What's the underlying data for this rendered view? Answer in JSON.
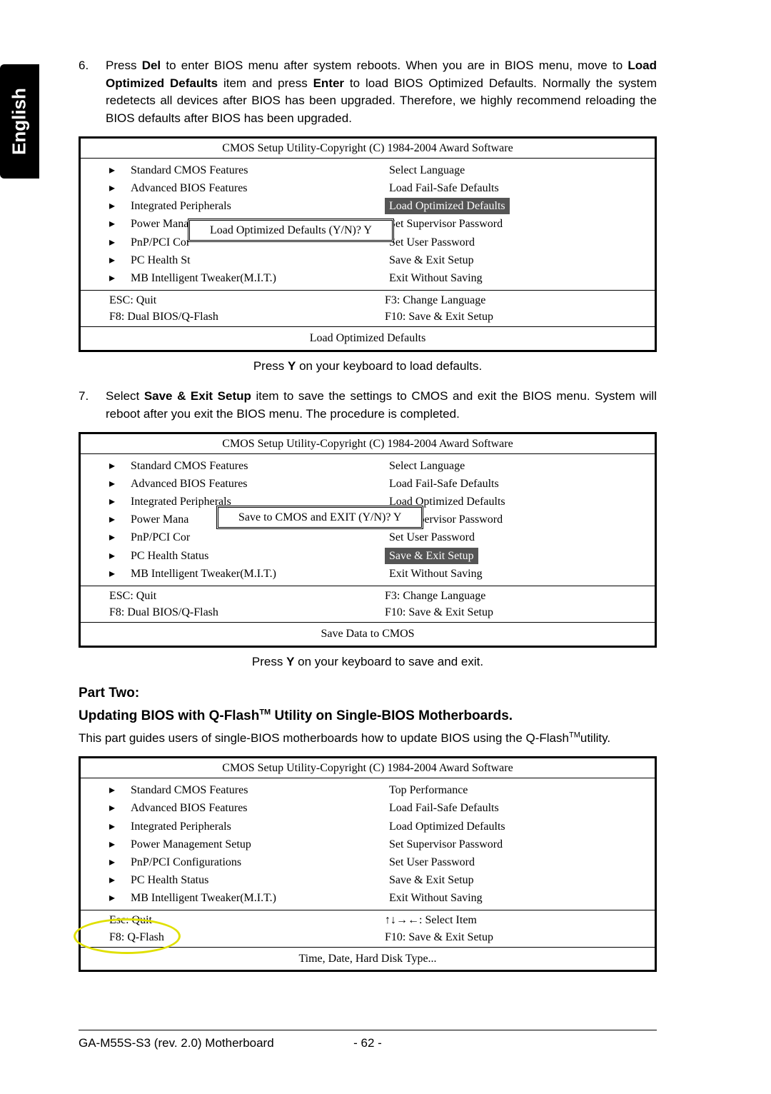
{
  "language_tab": "English",
  "step6": {
    "num": "6.",
    "pre": "Press ",
    "del": "Del",
    "mid1": " to enter BIOS menu after system reboots. When you are in BIOS menu, move to ",
    "bold_load": "Load Optimized Defaults",
    "mid2": " item and press ",
    "bold_enter": "Enter",
    "mid3": " to load BIOS Optimized Defaults. Normally the system redetects all devices after BIOS has been upgraded. Therefore, we highly recommend reloading the BIOS defaults after BIOS has been upgraded."
  },
  "bios_title": "CMOS Setup Utility-Copyright (C) 1984-2004 Award Software",
  "bios1": {
    "left": [
      "Standard CMOS Features",
      "Advanced BIOS Features",
      "Integrated Peripherals",
      "Power Management Setup",
      "PnP/PCI Configurations",
      "PC Health Status",
      "MB Intelligent Tweaker(M.I.T.)"
    ],
    "left_trunc": {
      "3": "Power Management Setup",
      "4": "PnP/PCI Cor",
      "5": "PC Health St"
    },
    "right": [
      "Select Language",
      "Load Fail-Safe Defaults",
      "Load Optimized Defaults",
      "Set Supervisor Password",
      "Set User Password",
      "Save & Exit Setup",
      "Exit Without Saving"
    ],
    "dialog": "Load Optimized Defaults (Y/N)? Y",
    "hints": {
      "esc": "ESC: Quit",
      "f8": "F8: Dual BIOS/Q-Flash",
      "f3": "F3: Change Language",
      "f10": "F10: Save & Exit Setup"
    },
    "footer": "Load Optimized Defaults"
  },
  "caption1": {
    "pre": "Press ",
    "key": "Y",
    "post": " on your keyboard to load defaults."
  },
  "step7": {
    "num": "7.",
    "pre": "Select ",
    "bold": "Save & Exit Setup",
    "mid": " item to save the settings to CMOS and exit the BIOS menu. System will reboot after you exit the BIOS menu. The procedure is completed."
  },
  "bios2": {
    "left_trunc": {
      "3": "Power Mana",
      "4": "PnP/PCI Cor"
    },
    "dialog": "Save to CMOS and EXIT (Y/N)? Y",
    "footer": "Save Data to CMOS"
  },
  "caption2": {
    "pre": "Press ",
    "key": "Y",
    "post": " on your keyboard to save and exit."
  },
  "part_two": "Part Two:",
  "part_two_sub_pre": "Updating BIOS with Q-Flash",
  "part_two_sub_tm": "TM",
  "part_two_sub_post": " Utility on Single-BIOS Motherboards.",
  "part_two_lead_pre": "This part guides users of single-BIOS motherboards how to update BIOS using the Q-Flash",
  "part_two_lead_tm": "TM",
  "part_two_lead_post": "utility.",
  "bios3": {
    "right0": "Top Performance",
    "hints": {
      "esc": "Esc: Quit",
      "f8": "F8: Q-Flash",
      "arrows": "↑↓→←: Select Item",
      "f10": "F10: Save & Exit Setup"
    },
    "footer": "Time, Date, Hard Disk Type..."
  },
  "footer": {
    "model": "GA-M55S-S3 (rev. 2.0) Motherboard",
    "page": "- 62 -"
  },
  "arrow_glyph": "▸"
}
